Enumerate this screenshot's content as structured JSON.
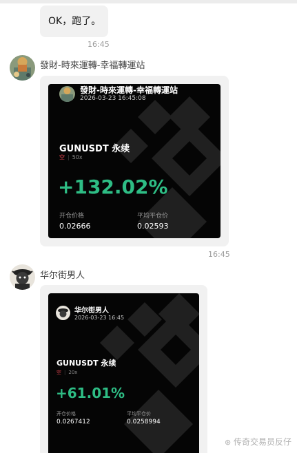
{
  "messages": {
    "first": {
      "text": "OK，跑了。",
      "time": "16:45"
    },
    "second": {
      "sender": "發財-時來運轉-幸福轉運站",
      "time": "16:45",
      "card": {
        "name": "發財-時來運轉-幸福轉運站",
        "datetime": "2026-03-23 16:45:08",
        "symbol": "GUNUSDT 永续",
        "side": "空",
        "leverage": "50x",
        "pnl": "+132.02%",
        "entry_label": "开仓价格",
        "entry_value": "0.02666",
        "close_label": "平均平仓价",
        "close_value": "0.02593"
      }
    },
    "third": {
      "sender": "华尔街男人",
      "card": {
        "name": "华尔街男人",
        "datetime": "2026-03-23 16:45",
        "symbol": "GUNUSDT 永续",
        "side": "空",
        "leverage": "20x",
        "pnl": "+61.01%",
        "entry_label": "开仓价格",
        "entry_value": "0.0267412",
        "close_label": "平均平仓价",
        "close_value": "0.0258994"
      }
    }
  },
  "watermark": "传奇交易员反仔",
  "colors": {
    "profit": "#2ebd85",
    "short": "#e0444e",
    "card_bg": "#050505",
    "bubble": "#f1f1f1"
  }
}
